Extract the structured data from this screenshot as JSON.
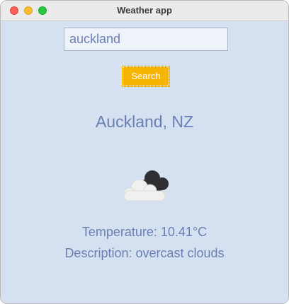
{
  "window": {
    "title": "Weather app"
  },
  "search": {
    "value": "auckland",
    "button_label": "Search"
  },
  "result": {
    "city": "Auckland, NZ",
    "temperature": "Temperature: 10.41°C",
    "description": "Description: overcast clouds",
    "icon": "overcast-clouds-icon"
  },
  "colors": {
    "accent": "#f6b500",
    "text": "#6a7eb4",
    "background": "#d5e1f0"
  }
}
